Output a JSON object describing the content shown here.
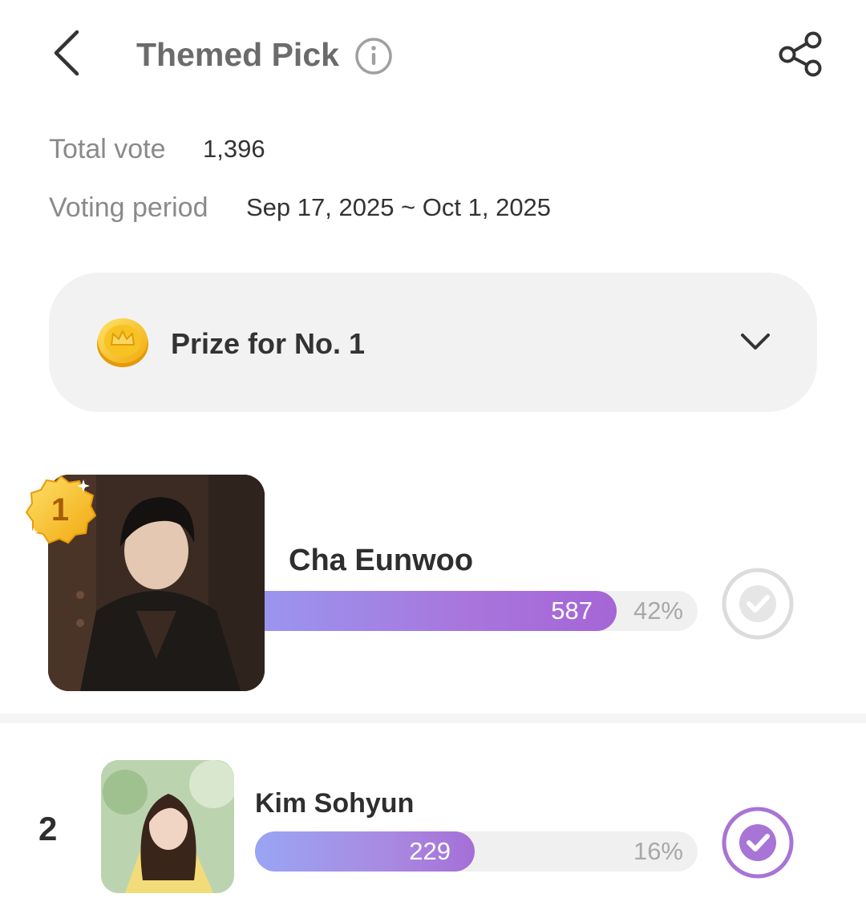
{
  "header": {
    "title": "Themed Pick",
    "back_icon": "chevron-left-icon",
    "info_icon": "info-icon",
    "share_icon": "share-icon"
  },
  "meta": {
    "total_vote_label": "Total vote",
    "total_vote_value": "1,396",
    "period_label": "Voting period",
    "period_value": "Sep 17, 2025 ~ Oct 1, 2025"
  },
  "prize": {
    "label": "Prize for No. 1",
    "icon": "coin-icon",
    "toggle_icon": "chevron-down-icon"
  },
  "candidates": [
    {
      "rank": "1",
      "name": "Cha Eunwoo",
      "votes": "587",
      "percent": "42%",
      "vote_share": 0.42,
      "badge_icon": "gold-medal-icon",
      "selected": false,
      "check_color": "#dcdcdc"
    },
    {
      "rank": "2",
      "name": "Kim Sohyun",
      "votes": "229",
      "percent": "16%",
      "vote_share": 0.16,
      "selected": true,
      "check_color": "#a874d6"
    }
  ],
  "colors": {
    "bar_start": "#9a95ee",
    "bar_end": "#a565d6",
    "panel_bg": "#f2f2f2",
    "check_active": "#a874d6",
    "check_inactive": "#dcdcdc"
  }
}
